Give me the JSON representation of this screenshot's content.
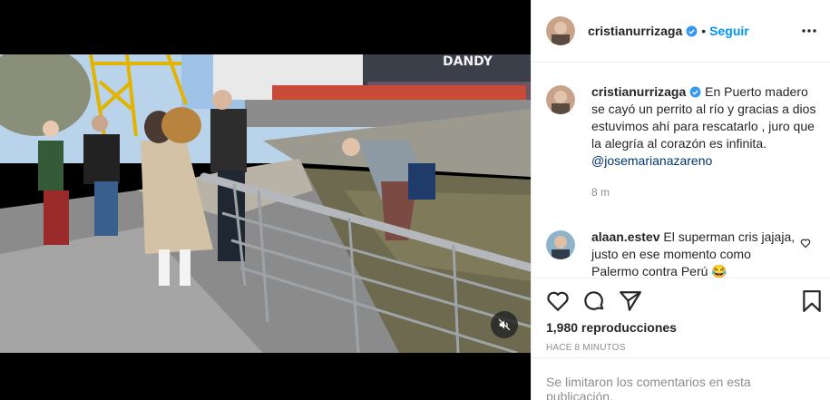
{
  "post": {
    "username": "cristianurrizaga",
    "follow_label": "Seguir",
    "separator": "•",
    "caption_text": "En Puerto madero se cayó un perrito al río y gracias a dios estuvimos ahí para rescatarlo , juro que la alegría al corazón es infinita.",
    "caption_mention": "@josemarianazareno",
    "caption_time": "8 m"
  },
  "comment": {
    "username": "alaan.estev",
    "text": "El superman cris jajaja, justo en ese momento como Palermo contra Perú 😂"
  },
  "actions": {
    "views": "1,980 reproducciones",
    "time_ago": "HACE 8 MINUTOS"
  },
  "footer": {
    "comments_disabled": "Se limitaron los comentarios en esta publicación."
  },
  "colors": {
    "accent": "#0095f6",
    "text": "#262626",
    "secondary": "#8e8e8e",
    "verified": "#3897f0"
  },
  "icons": [
    "verified-badge-icon",
    "more-options-icon",
    "heart-icon",
    "comment-icon",
    "share-icon",
    "save-icon",
    "mute-icon",
    "heart-small-icon"
  ]
}
